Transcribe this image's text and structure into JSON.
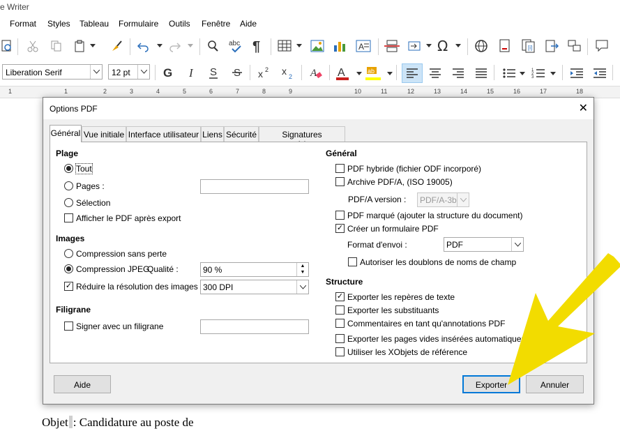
{
  "window": {
    "title": "e Writer"
  },
  "menu": [
    "Format",
    "Styles",
    "Tableau",
    "Formulaire",
    "Outils",
    "Fenêtre",
    "Aide"
  ],
  "format_bar": {
    "font_name": "Liberation Serif",
    "font_size": "12 pt"
  },
  "ruler": {
    "numbers": [
      "1",
      "1",
      "2",
      "3",
      "4",
      "5",
      "6",
      "7",
      "8",
      "9",
      "10",
      "11",
      "12",
      "13",
      "14",
      "15",
      "16",
      "17",
      "18"
    ]
  },
  "document": {
    "text_before_cursor": "Objet",
    "text_after_cursor": ": Candidature au poste de"
  },
  "dialog": {
    "title": "Options PDF",
    "close_glyph": "✕",
    "tabs": [
      "Général",
      "Vue initiale",
      "Interface utilisateur",
      "Liens",
      "Sécurité",
      "Signatures numériques"
    ],
    "left": {
      "plage": {
        "header": "Plage",
        "all": "Tout",
        "pages": "Pages :",
        "pages_value": "",
        "selection": "Sélection",
        "view_after": "Afficher le PDF après export"
      },
      "images": {
        "header": "Images",
        "lossless": "Compression sans perte",
        "jpeg": "Compression JPEG",
        "quality": "Qualité :",
        "quality_value": "90 %",
        "reduce": "Réduire la résolution des images",
        "dpi_value": "300 DPI"
      },
      "filigrane": {
        "header": "Filigrane",
        "sign": "Signer avec un filigrane",
        "sign_value": ""
      }
    },
    "right": {
      "general": {
        "header": "Général",
        "hybrid": "PDF hybride (fichier ODF incorporé)",
        "archive": "Archive PDF/A, (ISO 19005)",
        "pdfa_label": "PDF/A version :",
        "pdfa_value": "PDF/A-3b",
        "tagged": "PDF marqué (ajouter la structure du document)",
        "form": "Créer un formulaire PDF",
        "submit_label": "Format d'envoi :",
        "submit_value": "PDF",
        "dup_names": "Autoriser les doublons de noms de champ"
      },
      "structure": {
        "header": "Structure",
        "bookmarks": "Exporter les repères de texte",
        "placeholders": "Exporter les substituants",
        "comments": "Commentaires en tant qu'annotations PDF",
        "blank_pages": "Exporter les pages vides insérées automatiquement",
        "xobjects": "Utiliser les XObjets de référence"
      }
    },
    "buttons": {
      "help": "Aide",
      "export": "Exporter",
      "cancel": "Annuler"
    }
  },
  "colors": {
    "accent": "#0078d7",
    "arrow": "#f2dc00"
  }
}
